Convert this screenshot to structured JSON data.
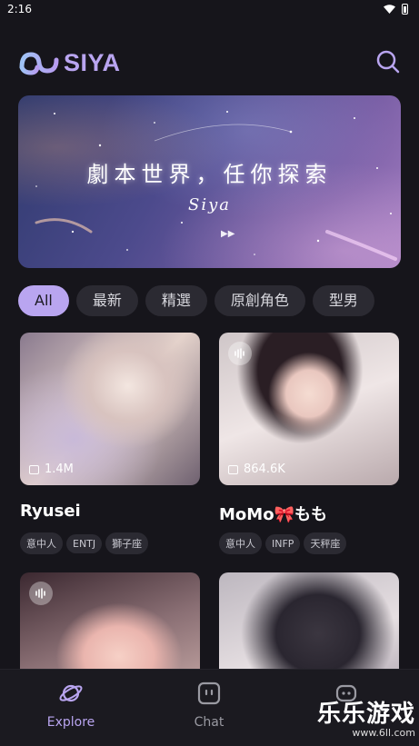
{
  "status": {
    "time": "2:16"
  },
  "header": {
    "logo_text": "SIYA"
  },
  "banner": {
    "title": "劇本世界，任你探索",
    "subtitle": "Siya"
  },
  "chips": [
    "All",
    "最新",
    "精選",
    "原創角色",
    "型男"
  ],
  "cards": [
    {
      "name": "Ryusei",
      "count": "1.4M",
      "tags": [
        "意中人",
        "ENTJ",
        "獅子座"
      ]
    },
    {
      "name": "MoMo🎀もも",
      "count": "864.6K",
      "tags": [
        "意中人",
        "INFP",
        "天秤座"
      ]
    }
  ],
  "nav": {
    "explore": "Explore",
    "chat": "Chat"
  },
  "watermark": {
    "line1": "乐乐游戏",
    "line2": "www.6ll.com"
  },
  "colors": {
    "accent": "#b9a5f0",
    "background": "#16151b"
  }
}
